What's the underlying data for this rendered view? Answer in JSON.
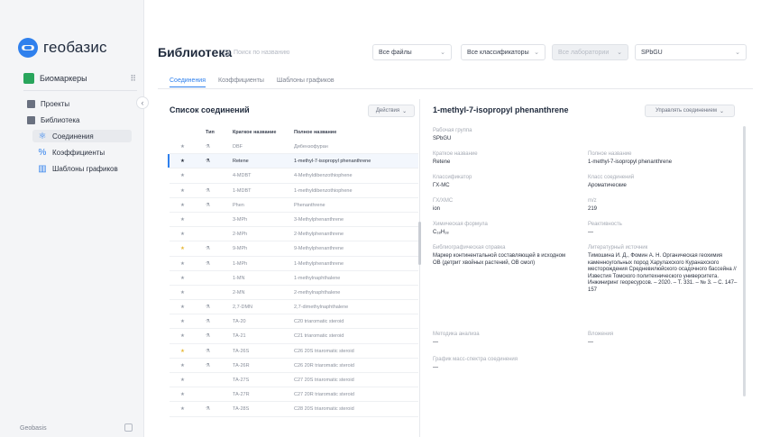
{
  "app": {
    "logo_text": "геобазис",
    "workspace": "Биомаркеры",
    "workspace_menu_icon": "dots-grid-icon"
  },
  "sidebar": {
    "items": [
      {
        "label": "Проекты",
        "icon": "folder-icon"
      },
      {
        "label": "Библиотека",
        "icon": "book-icon"
      }
    ],
    "subitems": [
      {
        "label": "Соединения",
        "icon": "molecule-icon",
        "active": true
      },
      {
        "label": "Коэффициенты",
        "icon": "percent-icon",
        "active": false
      },
      {
        "label": "Шаблоны графиков",
        "icon": "chart-icon",
        "active": false
      }
    ],
    "collapse_glyph": "‹",
    "user": "Geobasis"
  },
  "header": {
    "title": "Библиотека",
    "search_placeholder": "Поиск по названию",
    "filters": [
      {
        "value": "Все файлы",
        "disabled": false
      },
      {
        "value": "Все классификаторы",
        "disabled": false
      },
      {
        "value": "Все лаборатории",
        "disabled": true
      },
      {
        "value": "SPbGU",
        "disabled": false
      }
    ]
  },
  "tabs": [
    {
      "label": "Соединения",
      "active": true
    },
    {
      "label": "Коэффициенты",
      "active": false
    },
    {
      "label": "Шаблоны графиков",
      "active": false
    }
  ],
  "list": {
    "title": "Список соединений",
    "actions_label": "Действия",
    "columns": [
      "",
      "Тип",
      "Краткое название",
      "Полное название"
    ],
    "rows": [
      {
        "star": "★",
        "gold": false,
        "type": "⚗",
        "short": "DBF",
        "full": "Дибензофуран"
      },
      {
        "star": "★",
        "gold": false,
        "type": "⚗",
        "short": "Retene",
        "full": "1-methyl-7-isopropyl phenanthrene",
        "selected": true
      },
      {
        "star": "★",
        "gold": false,
        "type": "",
        "short": "4-MDBT",
        "full": "4-Methyldibenzothiophene"
      },
      {
        "star": "★",
        "gold": false,
        "type": "⚗",
        "short": "1-MDBT",
        "full": "1-methyldibenzothiophene"
      },
      {
        "star": "★",
        "gold": false,
        "type": "⚗",
        "short": "Phen",
        "full": "Phenanthrene"
      },
      {
        "star": "★",
        "gold": false,
        "type": "",
        "short": "3-MPh",
        "full": "3-Methylphenanthrene"
      },
      {
        "star": "★",
        "gold": false,
        "type": "",
        "short": "2-MPh",
        "full": "2-Methylphenanthrene"
      },
      {
        "star": "★",
        "gold": true,
        "type": "⚗",
        "short": "9-MPh",
        "full": "9-Methylphenanthrene"
      },
      {
        "star": "★",
        "gold": false,
        "type": "⚗",
        "short": "1-MPh",
        "full": "1-Methylphenanthrene"
      },
      {
        "star": "★",
        "gold": false,
        "type": "",
        "short": "1-MN",
        "full": "1-methylnaphthalene"
      },
      {
        "star": "★",
        "gold": false,
        "type": "",
        "short": "2-MN",
        "full": "2-methylnaphthalene"
      },
      {
        "star": "★",
        "gold": false,
        "type": "⚗",
        "short": "2,7-DMN",
        "full": "2,7-dimethylnaphthalene"
      },
      {
        "star": "★",
        "gold": false,
        "type": "⚗",
        "short": "TA-20",
        "full": "C20 triaromatic steroid"
      },
      {
        "star": "★",
        "gold": false,
        "type": "⚗",
        "short": "TA-21",
        "full": "C21 triaromatic steroid"
      },
      {
        "star": "★",
        "gold": true,
        "type": "⚗",
        "short": "TA-26S",
        "full": "C26 20S triaromatic steroid"
      },
      {
        "star": "★",
        "gold": false,
        "type": "⚗",
        "short": "TA-26R",
        "full": "C26 20R triaromatic steroid"
      },
      {
        "star": "★",
        "gold": false,
        "type": "",
        "short": "TA-27S",
        "full": "C27 20S triaromatic steroid"
      },
      {
        "star": "★",
        "gold": false,
        "type": "",
        "short": "TA-27R",
        "full": "C27 20R triaromatic steroid"
      },
      {
        "star": "★",
        "gold": false,
        "type": "⚗",
        "short": "TA-28S",
        "full": "C28 20S triaromatic steroid"
      }
    ]
  },
  "detail": {
    "title": "1-methyl-7-isopropyl phenanthrene",
    "manage_label": "Управлять соединением",
    "fields": {
      "group_label": "Рабочая группа",
      "group_value": "SPbGU",
      "short_label": "Краткое название",
      "short_value": "Retene",
      "full_label": "Полное название",
      "full_value": "1-methyl-7-isopropyl phenanthrene",
      "classifier_label": "Классификатор",
      "classifier_value": "ГХ-МС",
      "class_label": "Класс соединений",
      "class_value": "Ароматические",
      "ion_label": "ГХ/ХМС",
      "ion_value": "ion",
      "mz_label": "m/z",
      "mz_value": "219",
      "formula_label": "Химическая формула",
      "formula_value": "C₁₈H₁₈",
      "retention_label": "Реактивность",
      "retention_value": "—",
      "biblio_label": "Библиографическая справка",
      "biblio_value": "Маркер континентальной составляющей в исходном ОВ (детрит хвойных растений, ОВ смол)",
      "lit_label": "Литературный источник",
      "lit_value": "Тимошина И. Д., Фомин А. Н. Органическая геохимия каменноугольных пород Харулахского Куранахского месторождения Средневилюйского осадочного бассейна // Известия Томского политехнического университета. Инжиниринг георесурсов. – 2020. – Т. 331. – № 3. – С. 147–157",
      "method_label": "Методика анализа",
      "method_value": "—",
      "notes_label": "Вложения",
      "notes_value": "—",
      "chart_label": "График масс-спектра соединения",
      "chart_value": "—"
    }
  }
}
